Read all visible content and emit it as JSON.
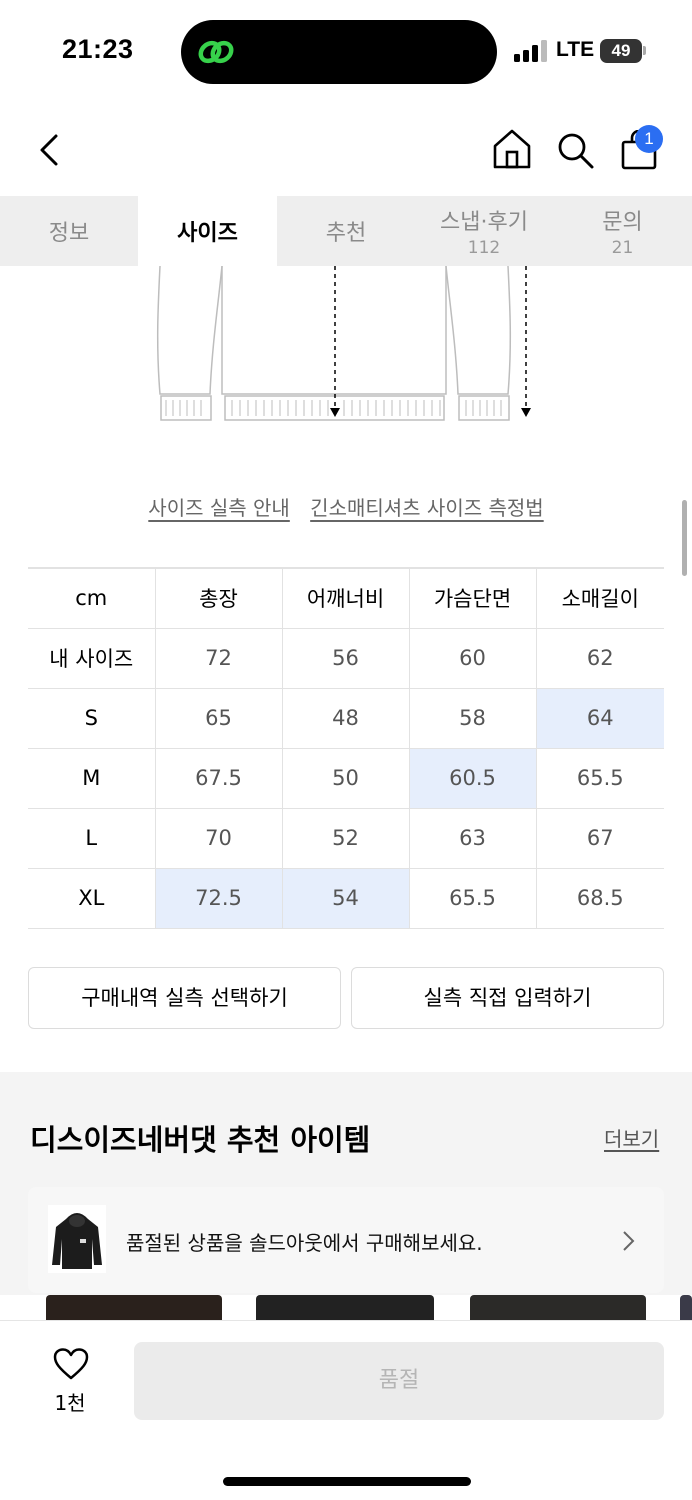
{
  "status_bar": {
    "time": "21:23",
    "network": "LTE",
    "battery": "49"
  },
  "header": {
    "cart_count": "1"
  },
  "tabs": [
    {
      "label": "정보",
      "count": ""
    },
    {
      "label": "사이즈",
      "count": ""
    },
    {
      "label": "추천",
      "count": ""
    },
    {
      "label": "스냅·후기",
      "count": "112"
    },
    {
      "label": "문의",
      "count": "21"
    }
  ],
  "size_links": {
    "guide": "사이즈 실측 안내",
    "method": "긴소매티셔츠 사이즈 측정법"
  },
  "size_table": {
    "headers": [
      "cm",
      "총장",
      "어깨너비",
      "가슴단면",
      "소매길이"
    ],
    "rows": [
      {
        "label": "내 사이즈",
        "values": [
          "72",
          "56",
          "60",
          "62"
        ]
      },
      {
        "label": "S",
        "values": [
          "65",
          "48",
          "58",
          "64"
        ]
      },
      {
        "label": "M",
        "values": [
          "67.5",
          "50",
          "60.5",
          "65.5"
        ]
      },
      {
        "label": "L",
        "values": [
          "70",
          "52",
          "63",
          "67"
        ]
      },
      {
        "label": "XL",
        "values": [
          "72.5",
          "54",
          "65.5",
          "68.5"
        ]
      }
    ],
    "highlight_color": "#e6eefc"
  },
  "actions": {
    "select_history": "구매내역 실측 선택하기",
    "direct_input": "실측 직접 입력하기"
  },
  "recommend": {
    "title": "디스이즈네버댓 추천 아이템",
    "more": "더보기",
    "soldout_text": "품절된 상품을 솔드아웃에서 구매해보세요."
  },
  "bottom_bar": {
    "like_count": "1천",
    "buy_label": "품절"
  },
  "colors": {
    "accent": "#2b6ef2",
    "tab_bg": "#eeeeee",
    "disabled_bg": "#ebebeb"
  }
}
